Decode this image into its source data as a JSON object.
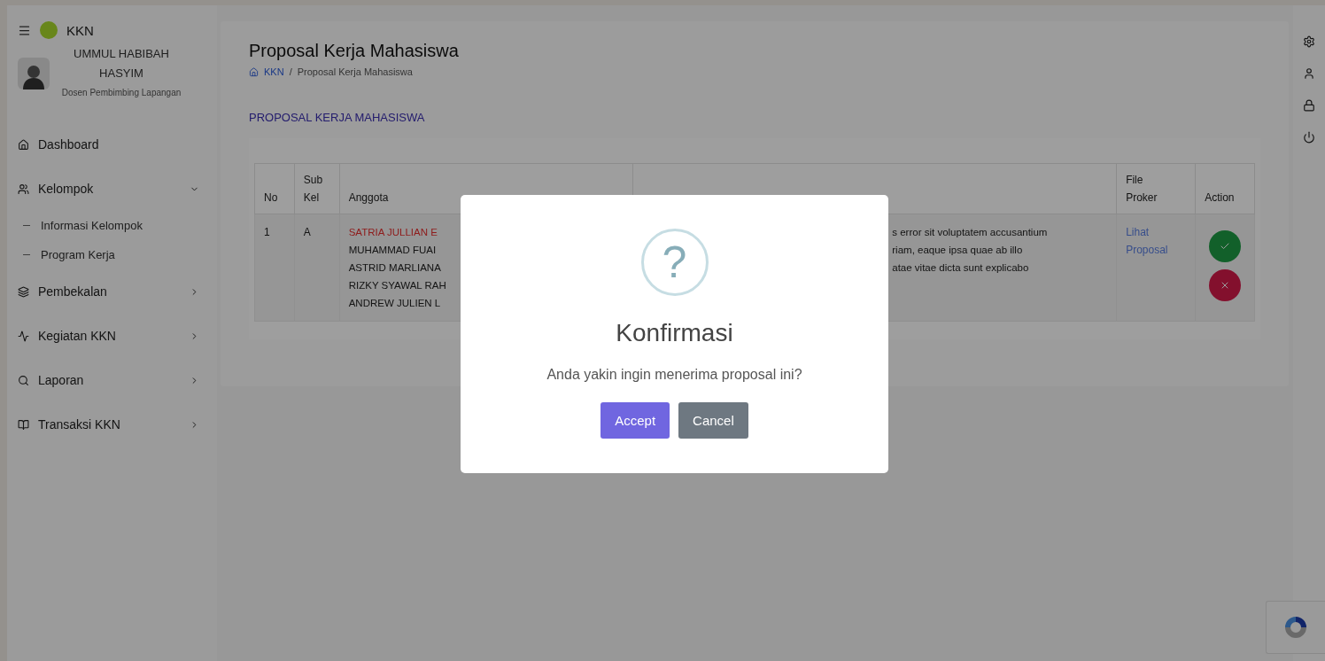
{
  "sidebar": {
    "brand": "KKN",
    "user": {
      "name": "UMMUL HABIBAH HASYIM",
      "role": "Dosen Pembimbing Lapangan"
    },
    "items": [
      {
        "kind": "link",
        "label": "Dashboard"
      },
      {
        "kind": "group",
        "label": "Kelompok",
        "expanded": true,
        "children": [
          {
            "label": "Informasi Kelompok"
          },
          {
            "label": "Program Kerja"
          }
        ]
      },
      {
        "kind": "group",
        "label": "Pembekalan",
        "expanded": false
      },
      {
        "kind": "group",
        "label": "Kegiatan KKN",
        "expanded": false
      },
      {
        "kind": "group",
        "label": "Laporan",
        "expanded": false
      },
      {
        "kind": "group",
        "label": "Transaksi KKN",
        "expanded": false
      }
    ]
  },
  "page": {
    "title": "Proposal Kerja Mahasiswa",
    "breadcrumb": [
      "KKN",
      "/",
      "Proposal Kerja Mahasiswa"
    ],
    "section_title": "PROPOSAL KERJA MAHASISWA"
  },
  "table": {
    "columns": [
      "No",
      "Sub Kel",
      "Anggota",
      "",
      "File Proker",
      "Action"
    ],
    "rows": [
      {
        "no": "1",
        "sub_kel": "A",
        "members": [
          {
            "name": "SATRIA JULLIAN E",
            "leader": true
          },
          {
            "name": "MUHAMMAD FUAI",
            "leader": false
          },
          {
            "name": "ASTRID MARLIANA",
            "leader": false
          },
          {
            "name": "RIZKY SYAWAL RAH",
            "leader": false
          },
          {
            "name": "ANDREW JULIEN L",
            "leader": false
          }
        ],
        "column_4": "s error sit voluptatem accusantium\nriam, eaque ipsa quae ab illo\natae vitae dicta sunt explicabo",
        "file_link": "Lihat Proposal"
      }
    ]
  },
  "modal": {
    "icon_glyph": "?",
    "title": "Konfirmasi",
    "message": "Anda yakin ingin menerima proposal ini?",
    "buttons": [
      {
        "kind": "primary",
        "label": "Accept"
      },
      {
        "kind": "secondary",
        "label": "Cancel"
      }
    ]
  }
}
